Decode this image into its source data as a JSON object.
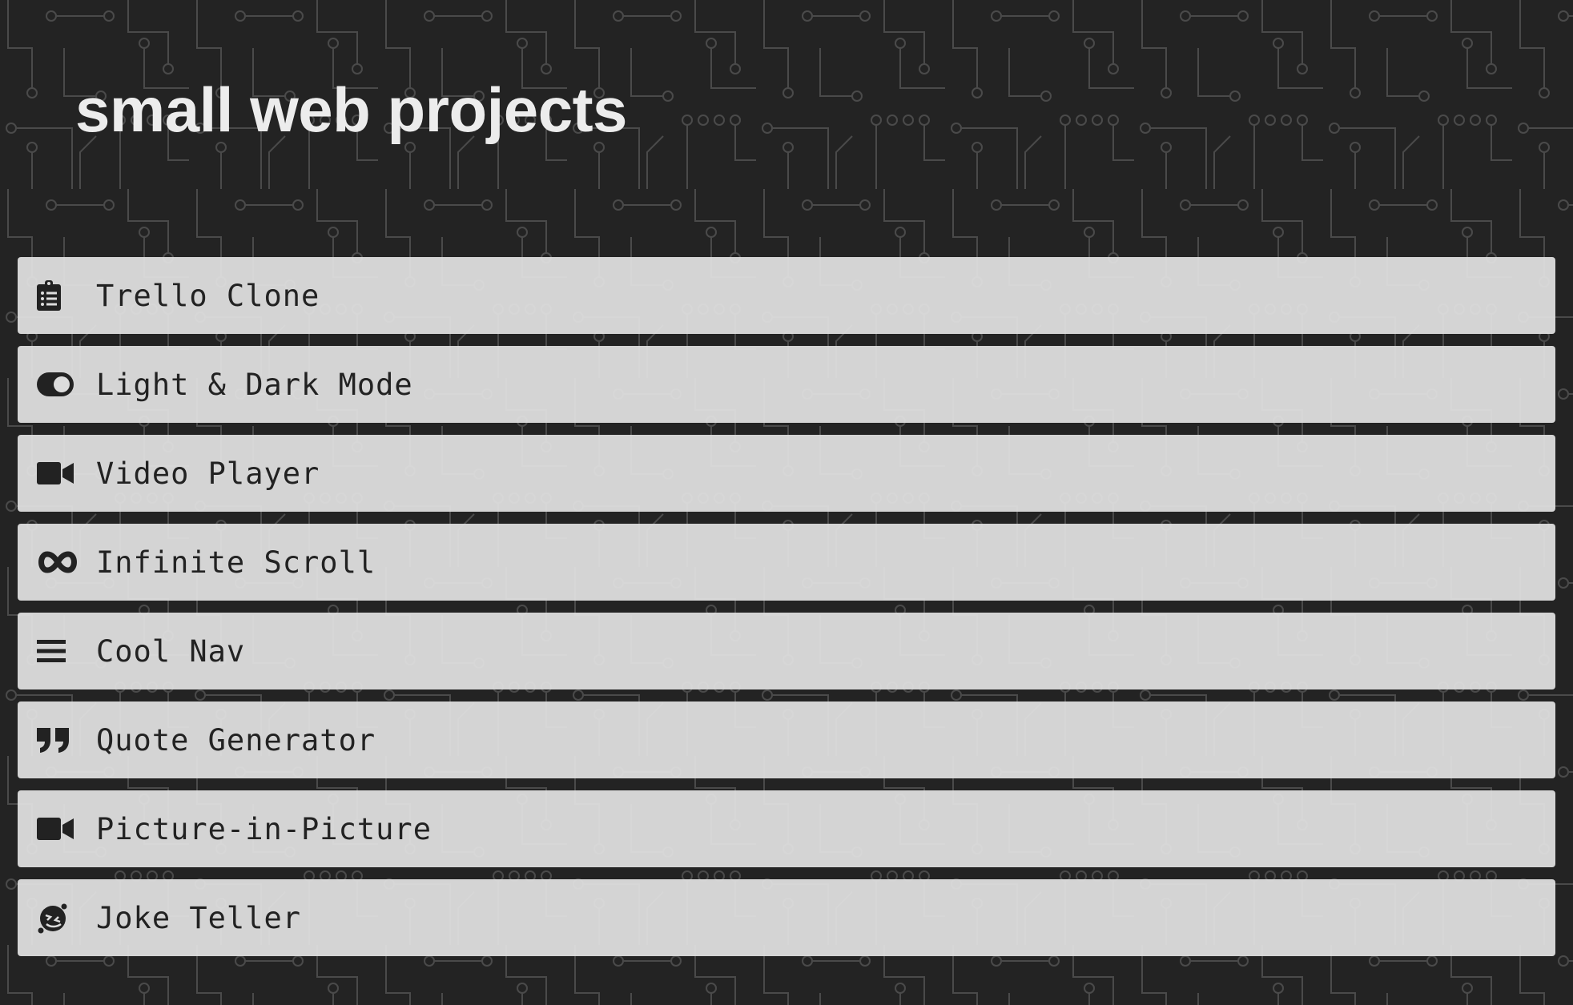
{
  "page": {
    "title": "small web projects"
  },
  "colors": {
    "background": "#232323",
    "card": "#dedede",
    "text": "#222222",
    "title": "#ececec"
  },
  "projects": [
    {
      "label": "Trello Clone",
      "icon": "clipboard-list-icon"
    },
    {
      "label": "Light & Dark Mode",
      "icon": "toggle-icon"
    },
    {
      "label": "Video Player",
      "icon": "video-camera-icon"
    },
    {
      "label": "Infinite Scroll",
      "icon": "infinity-icon"
    },
    {
      "label": "Cool Nav",
      "icon": "hamburger-menu-icon"
    },
    {
      "label": "Quote Generator",
      "icon": "quote-right-icon"
    },
    {
      "label": "Picture-in-Picture",
      "icon": "video-camera-icon"
    },
    {
      "label": "Joke Teller",
      "icon": "grin-squint-tears-icon"
    }
  ]
}
